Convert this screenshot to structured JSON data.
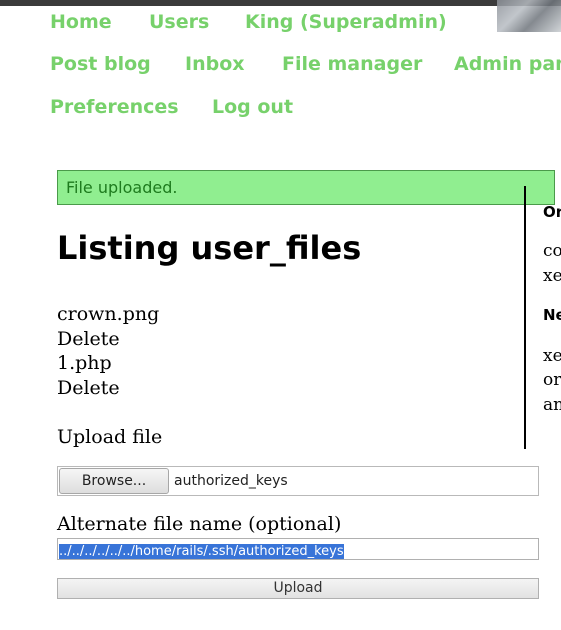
{
  "nav": {
    "home": "Home",
    "users": "Users",
    "king": "King (Superadmin)",
    "post_blog": "Post blog",
    "inbox": "Inbox",
    "file_manager": "File manager",
    "admin_panel": "Admin panel",
    "preferences": "Preferences",
    "log_out": "Log out"
  },
  "flash": {
    "message": "File uploaded."
  },
  "page": {
    "title": "Listing user_files"
  },
  "files": [
    {
      "name": "crown.png",
      "delete_label": "Delete"
    },
    {
      "name": "1.php",
      "delete_label": "Delete"
    }
  ],
  "upload_form": {
    "upload_label": "Upload file",
    "browse_label": "Browse...",
    "selected_file": "authorized_keys",
    "alt_label": "Alternate file name (optional)",
    "alt_value": "../../../../../../home/rails/.ssh/authorized_keys",
    "submit_label": "Upload"
  },
  "sidebar": {
    "heading1": "Or",
    "line1": "co",
    "line2": "xe",
    "heading2": "Ne",
    "line3": "xe",
    "line4": "or",
    "line5": "an"
  },
  "colors": {
    "nav_link": "#77d16b",
    "flash_bg": "#90ee90",
    "flash_text": "#1e7b1e",
    "selection": "#3874d8"
  }
}
